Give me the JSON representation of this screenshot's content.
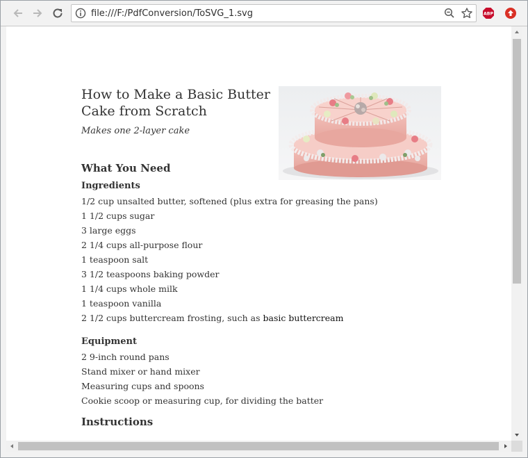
{
  "browser": {
    "url": "file:///F:/PdfConversion/ToSVG_1.svg",
    "extensions": [
      "adblock-plus-icon",
      "upload-extension-icon"
    ],
    "abp_label": "ABP"
  },
  "document": {
    "title": "How to Make a Basic Butter Cake from Scratch",
    "subtitle": "Makes one 2-layer cake",
    "what_you_need": "What You Need",
    "ingredients_heading": "Ingredients",
    "ingredients": [
      "1/2 cup unsalted butter, softened (plus extra for greasing the pans)",
      "1 1/2 cups sugar",
      "3 large eggs",
      "2 1/4 cups all-purpose flour",
      "1 teaspoon salt",
      "3 1/2 teaspoons baking powder",
      "1 1/4 cups whole milk",
      "1 teaspoon vanilla"
    ],
    "frosting_prefix": "2 1/2 cups buttercream frosting, such as ",
    "frosting_link": "basic buttercream",
    "equipment_heading": "Equipment",
    "equipment": [
      "2 9-inch round pans",
      "Stand mixer or hand mixer",
      "Measuring cups and spoons",
      "Cookie scoop or measuring cup, for dividing the batter"
    ],
    "instructions_heading": "Instructions"
  },
  "colors": {
    "chrome_bg": "#f2f2f2",
    "abp_red": "#c70d2c",
    "ext_red": "#d93025",
    "text": "#333333"
  }
}
